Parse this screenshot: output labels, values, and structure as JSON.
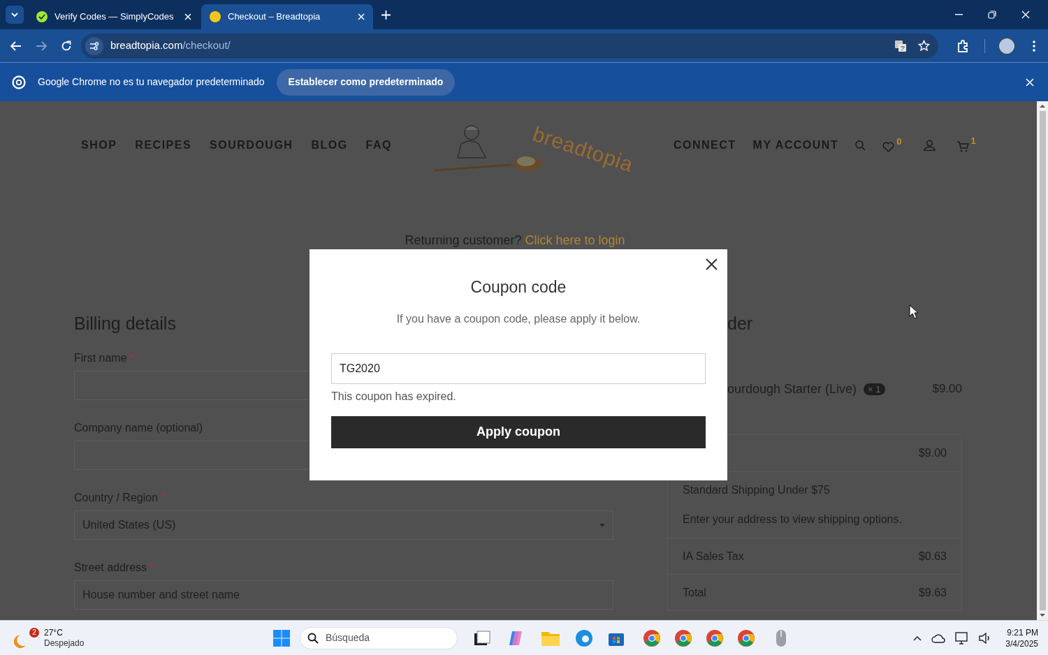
{
  "browser": {
    "tabs": [
      {
        "title": "Verify Codes — SimplyCodes",
        "selected": false
      },
      {
        "title": "Checkout – Breadtopia",
        "selected": true
      }
    ],
    "url_host": "breadtopia.com",
    "url_path": "/checkout/"
  },
  "infobar": {
    "message": "Google Chrome no es tu navegador predeterminado",
    "button": "Establecer como predeterminado"
  },
  "site_nav": {
    "left": [
      "SHOP",
      "RECIPES",
      "SOURDOUGH",
      "BLOG",
      "FAQ"
    ],
    "logo_text": "breadtopia",
    "right": [
      "CONNECT",
      "MY ACCOUNT"
    ],
    "wishlist_count": "0",
    "cart_count": "1"
  },
  "returning": {
    "text": "Returning customer?",
    "link": "Click here to login"
  },
  "billing": {
    "title": "Billing details",
    "fields": [
      {
        "kind": "input",
        "label": "First name",
        "required_mark": "*"
      },
      {
        "kind": "input",
        "label": "Company name (optional)"
      },
      {
        "kind": "select",
        "label": "Country / Region",
        "required_mark": "*",
        "value": "United States (US)"
      },
      {
        "kind": "input",
        "label": "Street address",
        "required_mark": "*",
        "placeholder": "House number and street name"
      }
    ]
  },
  "order": {
    "title": "der",
    "item": {
      "name": "ourdough Starter (Live)",
      "qty": "× 1",
      "price": "$9.00"
    },
    "rows": [
      {
        "kind": "amount",
        "value": "$9.00"
      },
      {
        "kind": "shipping",
        "label": "Standard Shipping Under $75",
        "note": "Enter your address to view shipping options."
      },
      {
        "kind": "amount",
        "label": "IA Sales Tax",
        "value": "$0.63"
      },
      {
        "kind": "amount",
        "label": "Total",
        "value": "$9.63"
      }
    ]
  },
  "modal": {
    "title": "Coupon code",
    "subtitle": "If you have a coupon code, please apply it below.",
    "code": "TG2020",
    "error": "This coupon has expired.",
    "button": "Apply coupon"
  },
  "taskbar": {
    "weather_badge": "2",
    "temperature": "27°C",
    "condition": "Despejado",
    "search_placeholder": "Búsqueda",
    "time": "9:21 PM",
    "date": "3/4/2025"
  }
}
